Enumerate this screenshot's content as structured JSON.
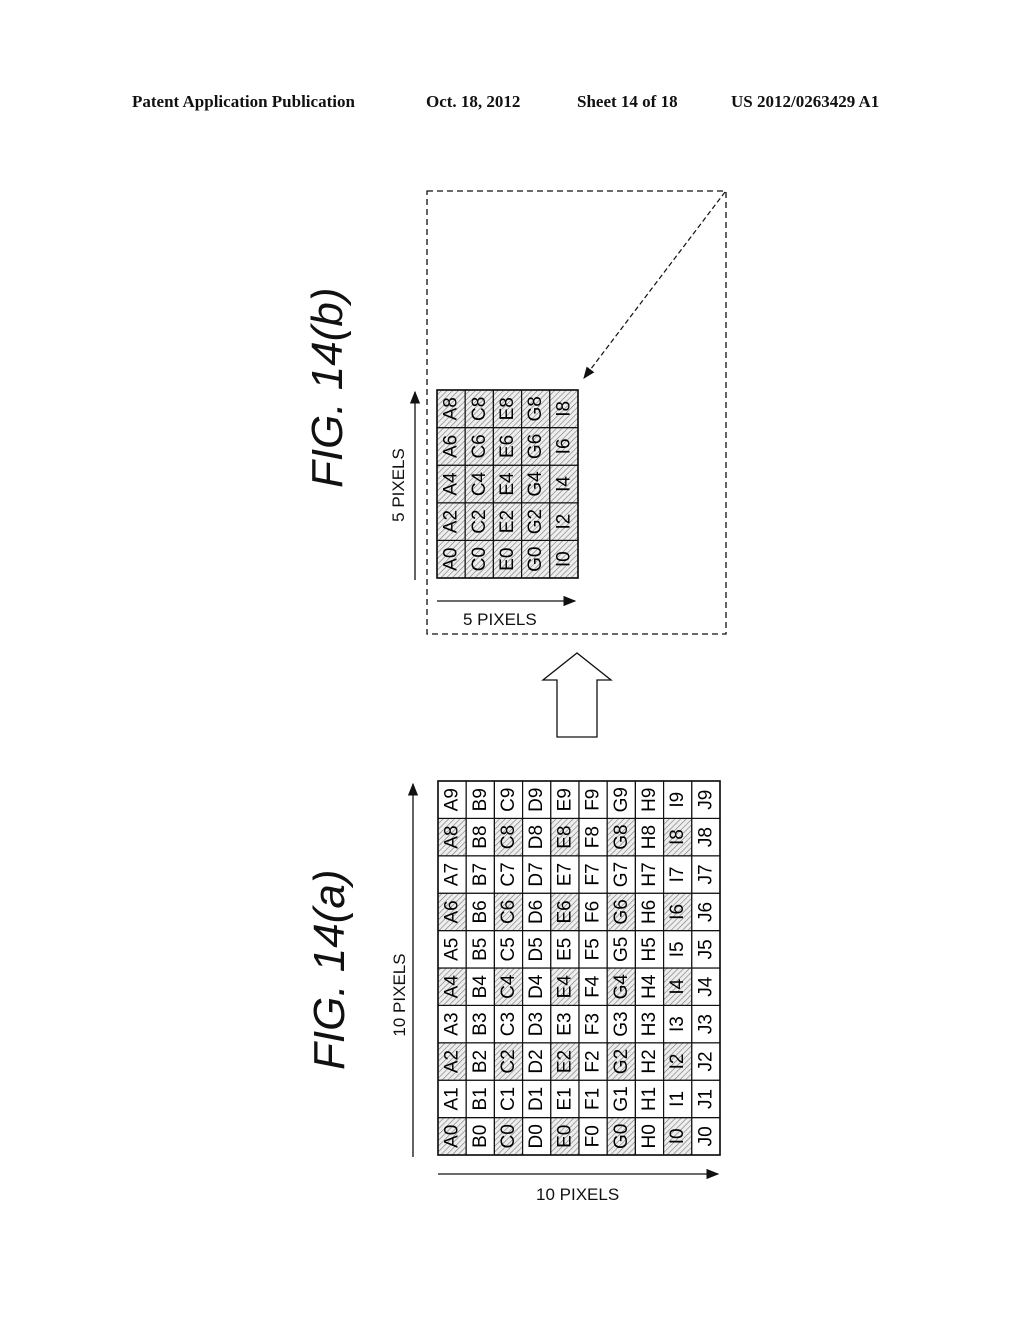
{
  "header": {
    "left": "Patent Application Publication",
    "date": "Oct. 18, 2012",
    "sheet": "Sheet 14 of 18",
    "number": "US 2012/0263429 A1"
  },
  "fig_a": {
    "title": "FIG.  14(a)",
    "x_label": "10 PIXELS",
    "y_label": "10 PIXELS",
    "rows": [
      "A",
      "B",
      "C",
      "D",
      "E",
      "F",
      "G",
      "H",
      "I",
      "J"
    ],
    "cols": [
      "0",
      "1",
      "2",
      "3",
      "4",
      "5",
      "6",
      "7",
      "8",
      "9"
    ],
    "shading_rule": "even row letter (A,C,E,G,I) and even column digit shaded"
  },
  "fig_b": {
    "title": "FIG.  14(b)",
    "x_label": "5 PIXELS",
    "y_label": "5 PIXELS",
    "rows": [
      "A",
      "C",
      "E",
      "G",
      "I"
    ],
    "cols": [
      "0",
      "2",
      "4",
      "6",
      "8"
    ],
    "shading_rule": "all cells shaded"
  },
  "colors": {
    "ink": "#111111",
    "hatch": "#777777"
  }
}
